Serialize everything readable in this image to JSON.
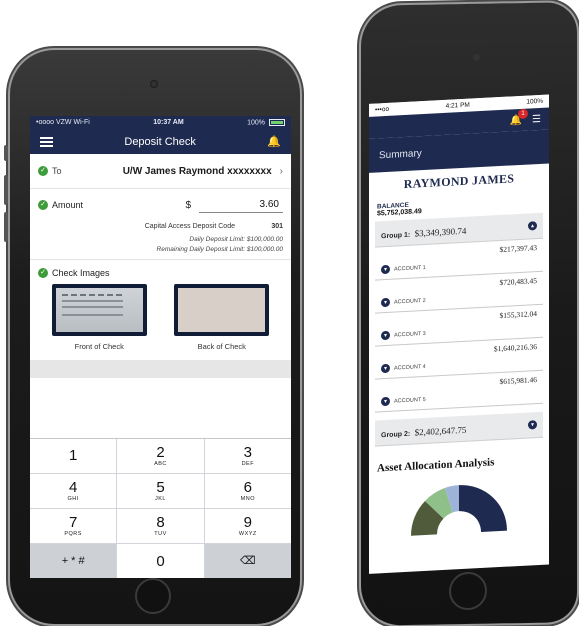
{
  "left_phone": {
    "status": {
      "carrier": "•oooo VZW Wi-Fi",
      "time": "10:37 AM",
      "battery": "100%"
    },
    "nav": {
      "title": "Deposit Check"
    },
    "to_row": {
      "label": "To",
      "value": "U/W James Raymond xxxxxxxx"
    },
    "amount": {
      "label": "Amount",
      "currency": "$",
      "value": "3.60",
      "code_label": "Capital Access Deposit Code",
      "code_value": "301",
      "daily_limit": "Daily Deposit Limit: $100,000.00",
      "remaining_limit": "Remaining Daily Deposit Limit: $100,000.00"
    },
    "images": {
      "heading": "Check Images",
      "front_caption": "Front of Check",
      "back_caption": "Back of Check"
    },
    "keypad": [
      {
        "num": "1",
        "letters": ""
      },
      {
        "num": "2",
        "letters": "ABC"
      },
      {
        "num": "3",
        "letters": "DEF"
      },
      {
        "num": "4",
        "letters": "GHI"
      },
      {
        "num": "5",
        "letters": "JKL"
      },
      {
        "num": "6",
        "letters": "MNO"
      },
      {
        "num": "7",
        "letters": "PQRS"
      },
      {
        "num": "8",
        "letters": "TUV"
      },
      {
        "num": "9",
        "letters": "WXYZ"
      },
      {
        "num": "+ * #",
        "letters": ""
      },
      {
        "num": "0",
        "letters": ""
      },
      {
        "num": "⌫",
        "letters": ""
      }
    ]
  },
  "right_phone": {
    "status": {
      "signal": "•••oo",
      "time": "4:21 PM",
      "battery": "100%"
    },
    "nav": {
      "badge": "1"
    },
    "summary_title": "Summary",
    "brand": "RAYMOND JAMES",
    "balance": {
      "label": "BALANCE",
      "value": "$5,752,038.49"
    },
    "group1": {
      "label": "Group 1:",
      "value": "$3,349,390.74"
    },
    "accounts": [
      {
        "name": "ACCOUNT 1",
        "value": "$217,397.43"
      },
      {
        "name": "ACCOUNT 2",
        "value": "$720,483.45"
      },
      {
        "name": "ACCOUNT 3",
        "value": "$155,312.04"
      },
      {
        "name": "ACCOUNT 4",
        "value": "$1,640,216.36"
      },
      {
        "name": "ACCOUNT 5",
        "value": "$615,981.46"
      }
    ],
    "group2": {
      "label": "Group 2:",
      "value": "$2,402,647.75"
    },
    "allocation_title": "Asset Allocation Analysis"
  },
  "colors": {
    "navy": "#1e2a4f",
    "check_green": "#3e9b3a",
    "badge_red": "#d62828"
  }
}
